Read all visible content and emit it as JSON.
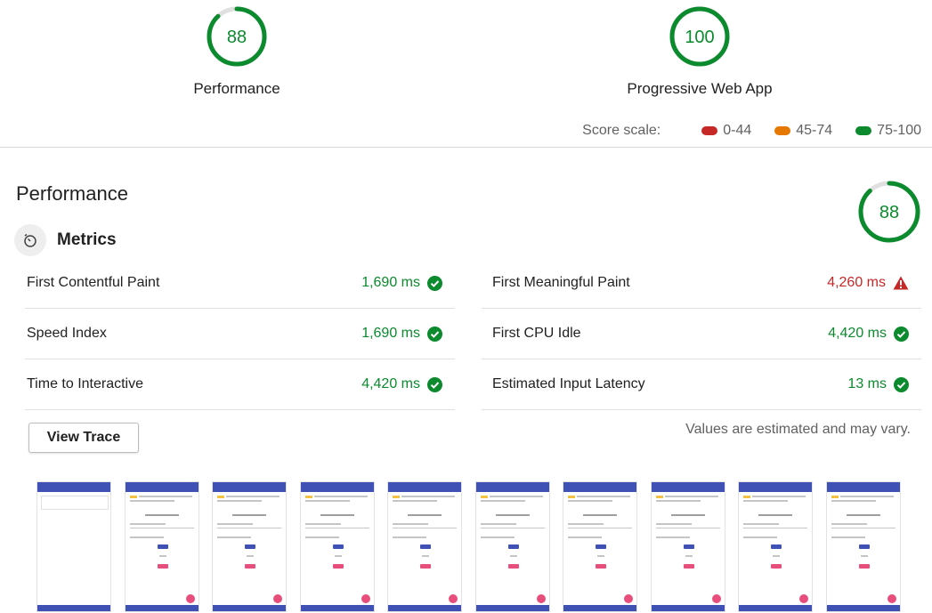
{
  "summary": {
    "performance": {
      "score": 88,
      "label": "Performance",
      "color": "#0b8a2e"
    },
    "pwa": {
      "score": 100,
      "label": "Progressive Web App",
      "color": "#0b8a2e"
    }
  },
  "score_scale": {
    "title": "Score scale:",
    "ranges": [
      {
        "label": "0-44",
        "color": "#c62828"
      },
      {
        "label": "45-74",
        "color": "#e67700"
      },
      {
        "label": "75-100",
        "color": "#0b8a2e"
      }
    ]
  },
  "section": {
    "title": "Performance",
    "score": 88,
    "metrics_title": "Metrics",
    "metrics_icon": "stopwatch-icon"
  },
  "metrics": {
    "left": [
      {
        "name": "First Contentful Paint",
        "value": "1,690 ms",
        "status": "pass",
        "icon": "check-circle-icon"
      },
      {
        "name": "Speed Index",
        "value": "1,690 ms",
        "status": "pass",
        "icon": "check-circle-icon"
      },
      {
        "name": "Time to Interactive",
        "value": "4,420 ms",
        "status": "pass",
        "icon": "check-circle-icon"
      }
    ],
    "right": [
      {
        "name": "First Meaningful Paint",
        "value": "4,260 ms",
        "status": "fail",
        "icon": "warning-triangle-icon"
      },
      {
        "name": "First CPU Idle",
        "value": "4,420 ms",
        "status": "pass",
        "icon": "check-circle-icon"
      },
      {
        "name": "Estimated Input Latency",
        "value": "13 ms",
        "status": "pass",
        "icon": "check-circle-icon"
      }
    ]
  },
  "actions": {
    "view_trace_label": "View Trace"
  },
  "note": "Values are estimated and may vary.",
  "filmstrip": {
    "frame_count": 10,
    "first_frame_blank": true
  }
}
